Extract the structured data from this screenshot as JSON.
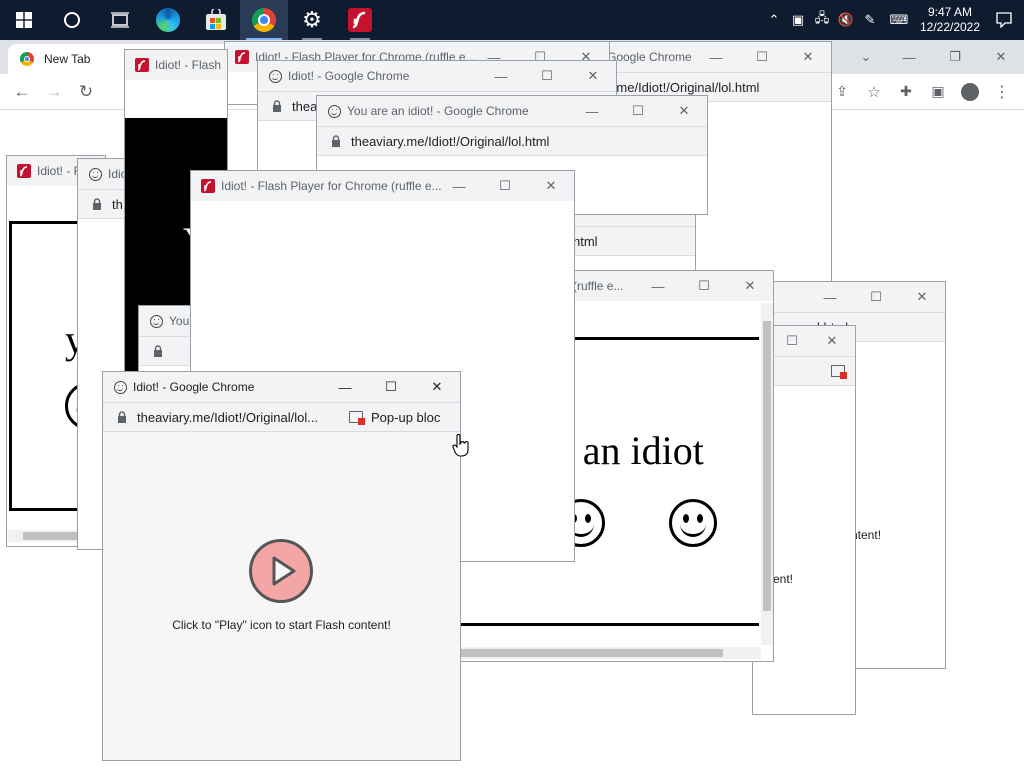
{
  "taskbar": {
    "apps": [
      {
        "name": "start",
        "label": "Start"
      },
      {
        "name": "search",
        "label": "Search"
      },
      {
        "name": "task-view",
        "label": "Task View"
      },
      {
        "name": "edge",
        "label": "Microsoft Edge"
      },
      {
        "name": "store",
        "label": "Microsoft Store"
      },
      {
        "name": "chrome",
        "label": "Google Chrome"
      },
      {
        "name": "settings",
        "label": "Settings"
      },
      {
        "name": "flash",
        "label": "Flash"
      }
    ],
    "clock": {
      "time": "9:47 AM",
      "date": "12/22/2022"
    }
  },
  "main_browser": {
    "tab_label": "New Tab"
  },
  "windows": {
    "w_chrome_right": {
      "title": "Google Chrome",
      "url": "theaviary.me/Idiot!/Original/lol.html"
    },
    "w_flash_top": {
      "title": "Idiot! - Flash Player for Chrome (ruffle e..."
    },
    "w_idiot_left": {
      "title": "Idiot! - F"
    },
    "w_idiot_left2": {
      "title": "Idio",
      "url": "th"
    },
    "w_flash_tall": {
      "title": "Idiot! - Flash"
    },
    "w_idiot_chrome1": {
      "title": "Idiot! - Google Chrome",
      "url": "thea"
    },
    "w_you_are": {
      "title": "You are an idiot! - Google Chrome",
      "url": "theaviary.me/Idiot!/Original/lol.html"
    },
    "w_flash_center": {
      "title": "Idiot! - Flash Player for Chrome (ruffle e..."
    },
    "w_mid_url": {
      "url_tail": "html"
    },
    "w_ruffle_right": {
      "title_tail": "e (ruffle e...",
      "big_text": "e an idiot"
    },
    "w_right_back": {
      "url_tail": "l.html",
      "text": "ntent!"
    },
    "w_right_back2": {
      "text": "ent!"
    },
    "w_small_you": {
      "title": "You a"
    },
    "w_front": {
      "title": "Idiot! - Google Chrome",
      "url": "theaviary.me/Idiot!/Original/lol...",
      "popup": "Pop-up bloc",
      "message": "Click to \"Play\" icon to start Flash content!"
    },
    "left_big": {
      "text": "y"
    },
    "tall_big": {
      "text": "Y"
    }
  },
  "colors": {
    "taskbar": "#0f1b2e",
    "titlebar": "#f1f3f4",
    "play_fill": "#f4a6a6"
  }
}
